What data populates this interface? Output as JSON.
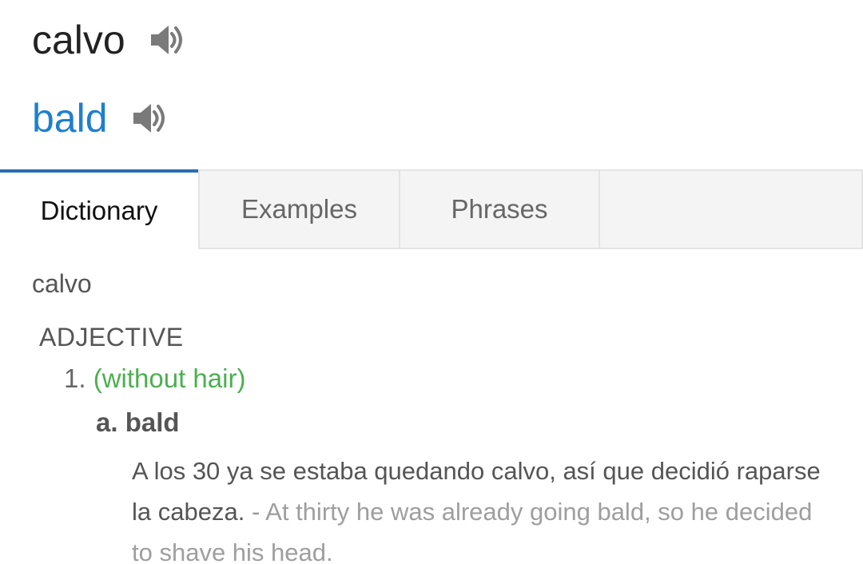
{
  "header": {
    "source_word": "calvo",
    "target_word": "bald",
    "source_audio_icon": "speaker-icon",
    "target_audio_icon": "speaker-icon"
  },
  "tabs": [
    {
      "label": "Dictionary",
      "active": true
    },
    {
      "label": "Examples",
      "active": false
    },
    {
      "label": "Phrases",
      "active": false
    }
  ],
  "entry": {
    "headword": "calvo",
    "part_of_speech": "ADJECTIVE",
    "senses": [
      {
        "number": "1.",
        "label": "(without hair)",
        "translations": [
          {
            "letter_word": "a. bald",
            "example_es": "A los 30 ya se estaba quedando calvo, así que decidió raparse la cabeza.",
            "separator": " - ",
            "example_en": "At thirty he was already going bald, so he decided to shave his head."
          }
        ]
      }
    ]
  },
  "colors": {
    "target_word": "#1e7fd0",
    "active_tab_indicator": "#2a6db5",
    "sense_label": "#4caf50",
    "example_translation": "#9e9e9e"
  }
}
